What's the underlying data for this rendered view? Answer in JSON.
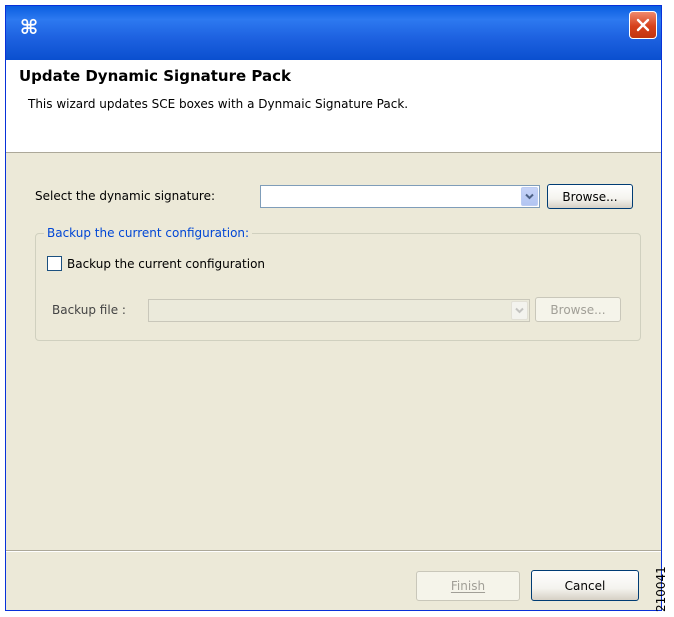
{
  "window": {
    "app_icon": "⌘",
    "icons": {
      "app": "cisco-scms-icon",
      "close": "close-icon",
      "dropdown": "chevron-down-icon"
    },
    "colors": {
      "titlebar": "#0a5ee0",
      "close_button": "#d6411c",
      "dialog_body": "#ece9d8",
      "group_label": "#0046d5"
    }
  },
  "header": {
    "title": "Update Dynamic Signature Pack",
    "description": "This wizard updates SCE boxes with a Dynmaic Signature Pack."
  },
  "signature": {
    "label": "Select the dynamic signature:",
    "value": "",
    "browse_label": "Browse..."
  },
  "backup_group": {
    "legend": "Backup the current configuration:",
    "checkbox_label": "Backup the current configuration",
    "checked": false,
    "file_label": "Backup file :",
    "file_value": "",
    "browse_label": "Browse..."
  },
  "footer": {
    "finish_label": "Finish",
    "cancel_label": "Cancel"
  },
  "figure_id": "210041"
}
